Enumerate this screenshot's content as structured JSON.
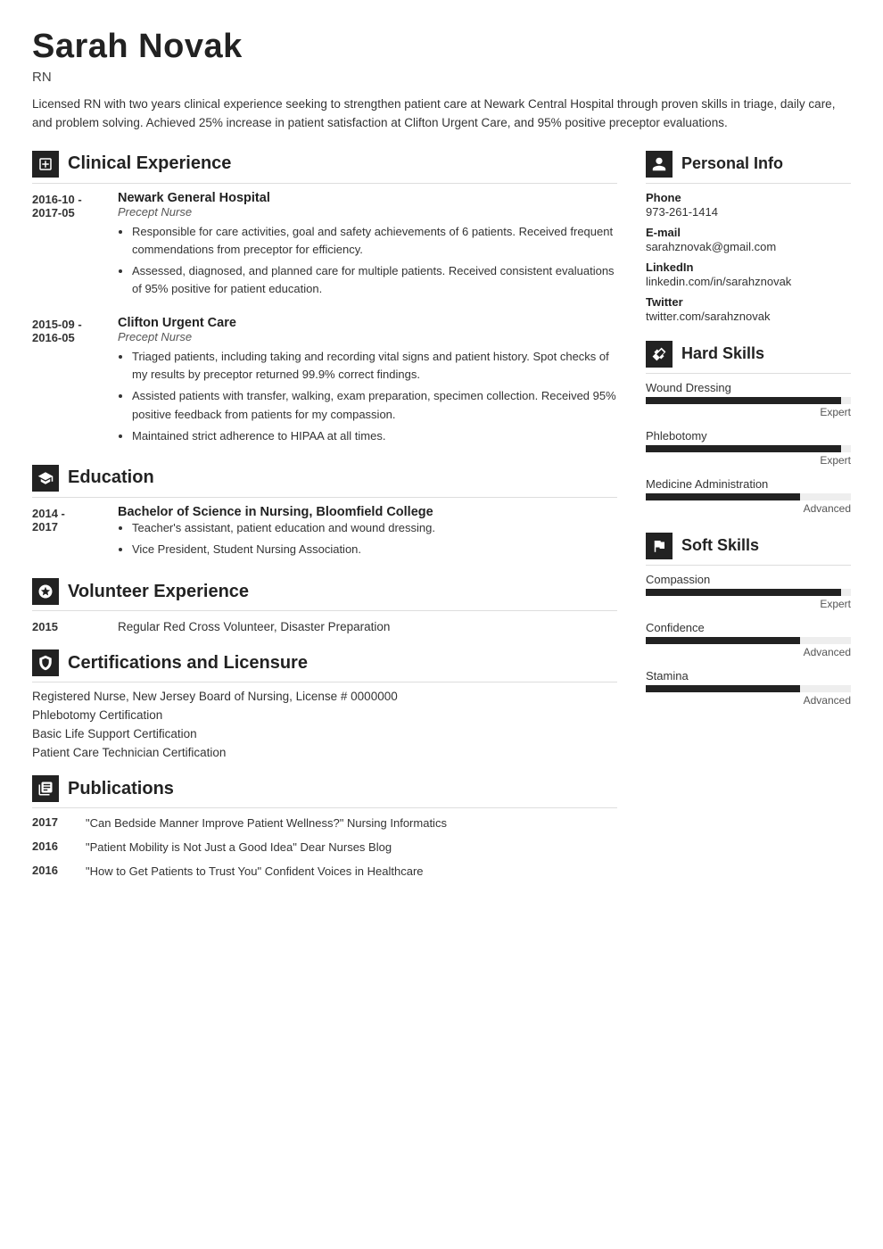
{
  "header": {
    "name": "Sarah Novak",
    "title": "RN",
    "summary": "Licensed RN with two years clinical experience seeking to strengthen patient care at Newark Central Hospital through proven skills in triage, daily care, and problem solving. Achieved 25% increase in patient satisfaction at Clifton Urgent Care, and 95% positive preceptor evaluations."
  },
  "sections": {
    "clinical_experience": {
      "title": "Clinical Experience",
      "entries": [
        {
          "date": "2016-10 -\n2017-05",
          "org": "Newark General Hospital",
          "role": "Precept Nurse",
          "bullets": [
            "Responsible for care activities, goal and safety achievements of 6 patients. Received frequent commendations from preceptor for efficiency.",
            "Assessed, diagnosed, and planned care for multiple patients. Received consistent evaluations of 95% positive for patient education."
          ]
        },
        {
          "date": "2015-09 -\n2016-05",
          "org": "Clifton Urgent Care",
          "role": "Precept Nurse",
          "bullets": [
            "Triaged patients, including taking and recording vital signs and patient history. Spot checks of my results by preceptor returned 99.9% correct findings.",
            "Assisted patients with transfer, walking, exam preparation, specimen collection. Received 95% positive feedback from patients for my compassion.",
            "Maintained strict adherence to HIPAA at all times."
          ]
        }
      ]
    },
    "education": {
      "title": "Education",
      "entries": [
        {
          "date": "2014 -\n2017",
          "org": "Bachelor of Science in Nursing, Bloomfield College",
          "bullets": [
            "Teacher's assistant, patient education and wound dressing.",
            "Vice President, Student Nursing Association."
          ]
        }
      ]
    },
    "volunteer": {
      "title": "Volunteer Experience",
      "entries": [
        {
          "date": "2015",
          "text": "Regular Red Cross Volunteer, Disaster Preparation"
        }
      ]
    },
    "certifications": {
      "title": "Certifications and Licensure",
      "items": [
        "Registered Nurse, New Jersey Board of Nursing, License # 0000000",
        "Phlebotomy Certification",
        "Basic Life Support Certification",
        "Patient Care Technician Certification"
      ]
    },
    "publications": {
      "title": "Publications",
      "entries": [
        {
          "date": "2017",
          "text": "\"Can Bedside Manner Improve Patient Wellness?\" Nursing Informatics"
        },
        {
          "date": "2016",
          "text": "\"Patient Mobility is Not Just a Good Idea\" Dear Nurses Blog"
        },
        {
          "date": "2016",
          "text": "\"How to Get Patients to Trust You\" Confident Voices in Healthcare"
        }
      ]
    }
  },
  "right": {
    "personal_info": {
      "title": "Personal Info",
      "fields": [
        {
          "label": "Phone",
          "value": "973-261-1414"
        },
        {
          "label": "E-mail",
          "value": "sarahznovak@gmail.com"
        },
        {
          "label": "LinkedIn",
          "value": "linkedin.com/in/sarahznovak"
        },
        {
          "label": "Twitter",
          "value": "twitter.com/sarahznovak"
        }
      ]
    },
    "hard_skills": {
      "title": "Hard Skills",
      "items": [
        {
          "name": "Wound Dressing",
          "level": "Expert",
          "pct": 95
        },
        {
          "name": "Phlebotomy",
          "level": "Expert",
          "pct": 95
        },
        {
          "name": "Medicine Administration",
          "level": "Advanced",
          "pct": 75
        }
      ]
    },
    "soft_skills": {
      "title": "Soft Skills",
      "items": [
        {
          "name": "Compassion",
          "level": "Expert",
          "pct": 95
        },
        {
          "name": "Confidence",
          "level": "Advanced",
          "pct": 75
        },
        {
          "name": "Stamina",
          "level": "Advanced",
          "pct": 75
        }
      ]
    }
  }
}
